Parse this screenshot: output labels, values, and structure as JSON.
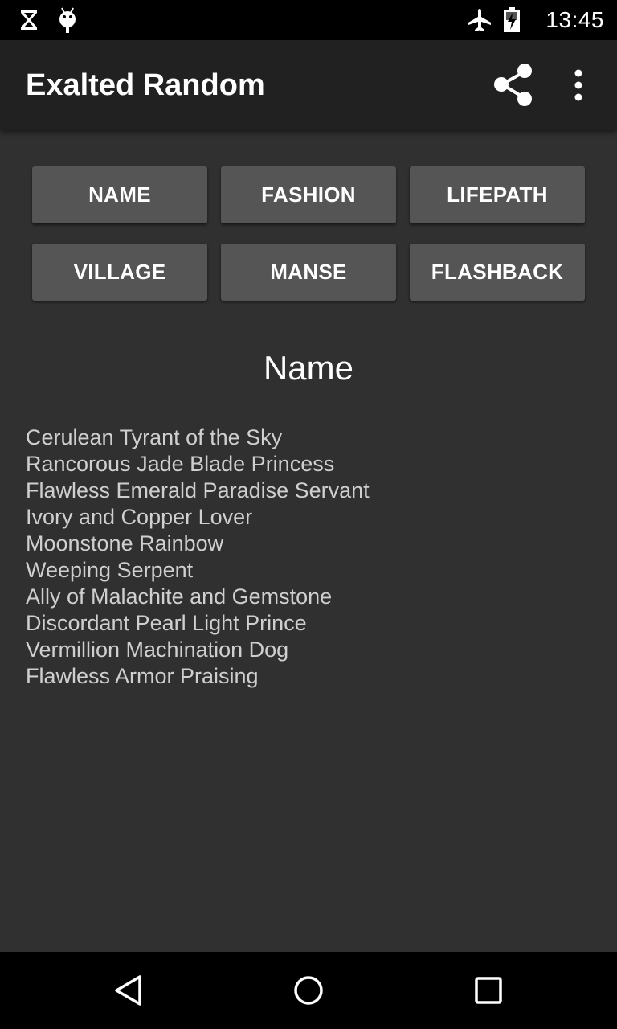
{
  "status_bar": {
    "time": "13:45",
    "left_icons": [
      "hourglass-icon",
      "android-debug-icon"
    ],
    "right_icons": [
      "airplane-mode-icon",
      "battery-charging-icon"
    ]
  },
  "app_bar": {
    "title": "Exalted Random",
    "actions": [
      "share-icon",
      "overflow-menu-icon"
    ]
  },
  "buttons": [
    {
      "label": "NAME"
    },
    {
      "label": "FASHION"
    },
    {
      "label": "LIFEPATH"
    },
    {
      "label": "VILLAGE"
    },
    {
      "label": "MANSE"
    },
    {
      "label": "FLASHBACK"
    }
  ],
  "section": {
    "title": "Name"
  },
  "results": [
    "Cerulean Tyrant of the Sky",
    "Rancorous Jade Blade Princess",
    "Flawless Emerald Paradise Servant",
    "Ivory and Copper Lover",
    "Moonstone Rainbow",
    "Weeping Serpent",
    "Ally of Malachite and Gemstone",
    "Discordant Pearl Light Prince",
    "Vermillion Machination Dog",
    "Flawless Armor Praising"
  ],
  "nav_bar": {
    "buttons": [
      "back-icon",
      "home-icon",
      "recents-icon"
    ]
  },
  "colors": {
    "background": "#303030",
    "app_bar": "#212121",
    "button": "#555555",
    "status_bar": "#000000",
    "result_text": "#cfcfcf"
  }
}
